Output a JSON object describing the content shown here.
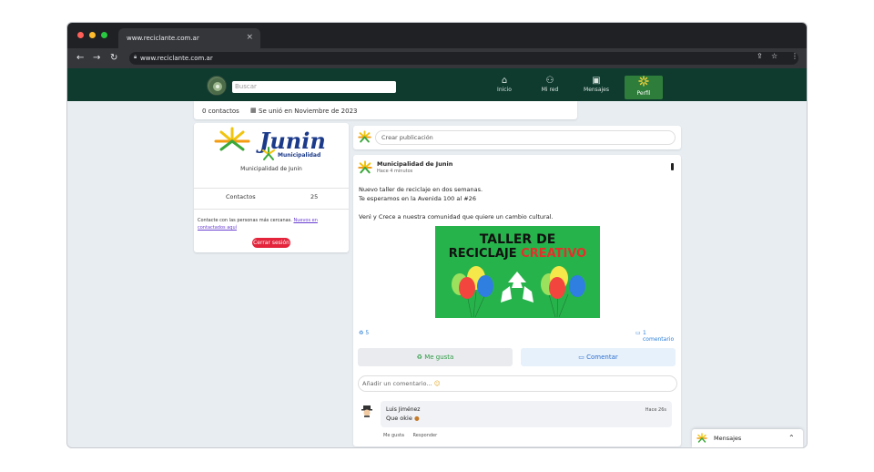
{
  "browser": {
    "tab_title": "www.reciclante.com.ar",
    "tab_close": "×",
    "url": "www.reciclante.com.ar",
    "traffic_colors": [
      "#ff5f57",
      "#febc2e",
      "#28c840"
    ]
  },
  "site": {
    "search_placeholder": "Buscar",
    "nav": [
      {
        "label": "Inicio",
        "icon": "home-icon",
        "glyph": "⌂"
      },
      {
        "label": "Mi red",
        "icon": "network-icon",
        "glyph": "⚇"
      },
      {
        "label": "Mensajes",
        "icon": "chat-icon",
        "glyph": "▣"
      },
      {
        "label": "Perfil",
        "icon": "profile-icon",
        "glyph": "✷"
      }
    ],
    "header_color": "#0f3b2f",
    "active_color": "#2f7d3a"
  },
  "profile_top": {
    "contacts": "0 contactos",
    "joined": "Se unió en Noviembre de 2023"
  },
  "left_card": {
    "logo_title": "Junin",
    "logo_subtitle": "Municipalidad",
    "name": "Municipalidad de Junin",
    "contacts_label": "Contactos",
    "contacts_count": "25",
    "info_text": "Contacte con las personas más cercanas.",
    "info_link": "Nuevos en contactados aquí",
    "logout_label": "Cerrar sesión"
  },
  "create_post": {
    "placeholder": "Crear publicación"
  },
  "post": {
    "author": "Municipalidad de Junin",
    "time": "Hace 4 minutos",
    "line1": "Nuevo taller de reciclaje en dos semanas.",
    "line2": "Te esperamos en la Avenida 100 al #26",
    "line3": "Venì y Crece a nuestra comunidad que quiere un cambio cultural.",
    "image_title1": "TALLER DE",
    "image_title2a": "RECICLAJE ",
    "image_title2b": "CREATIVO",
    "likes": "5",
    "comments_count": "1 comentario",
    "like_label": "Me gusta",
    "comment_label": "Comentar",
    "comment_placeholder": "Añadir un comentario..."
  },
  "comment": {
    "author": "Luis Jiménez",
    "text": "Que okie",
    "time": "Hace 26s",
    "like": "Me gusta",
    "reply": "Responder"
  },
  "messages_bar": {
    "label": "Mensajes",
    "chevron": "⌃"
  }
}
